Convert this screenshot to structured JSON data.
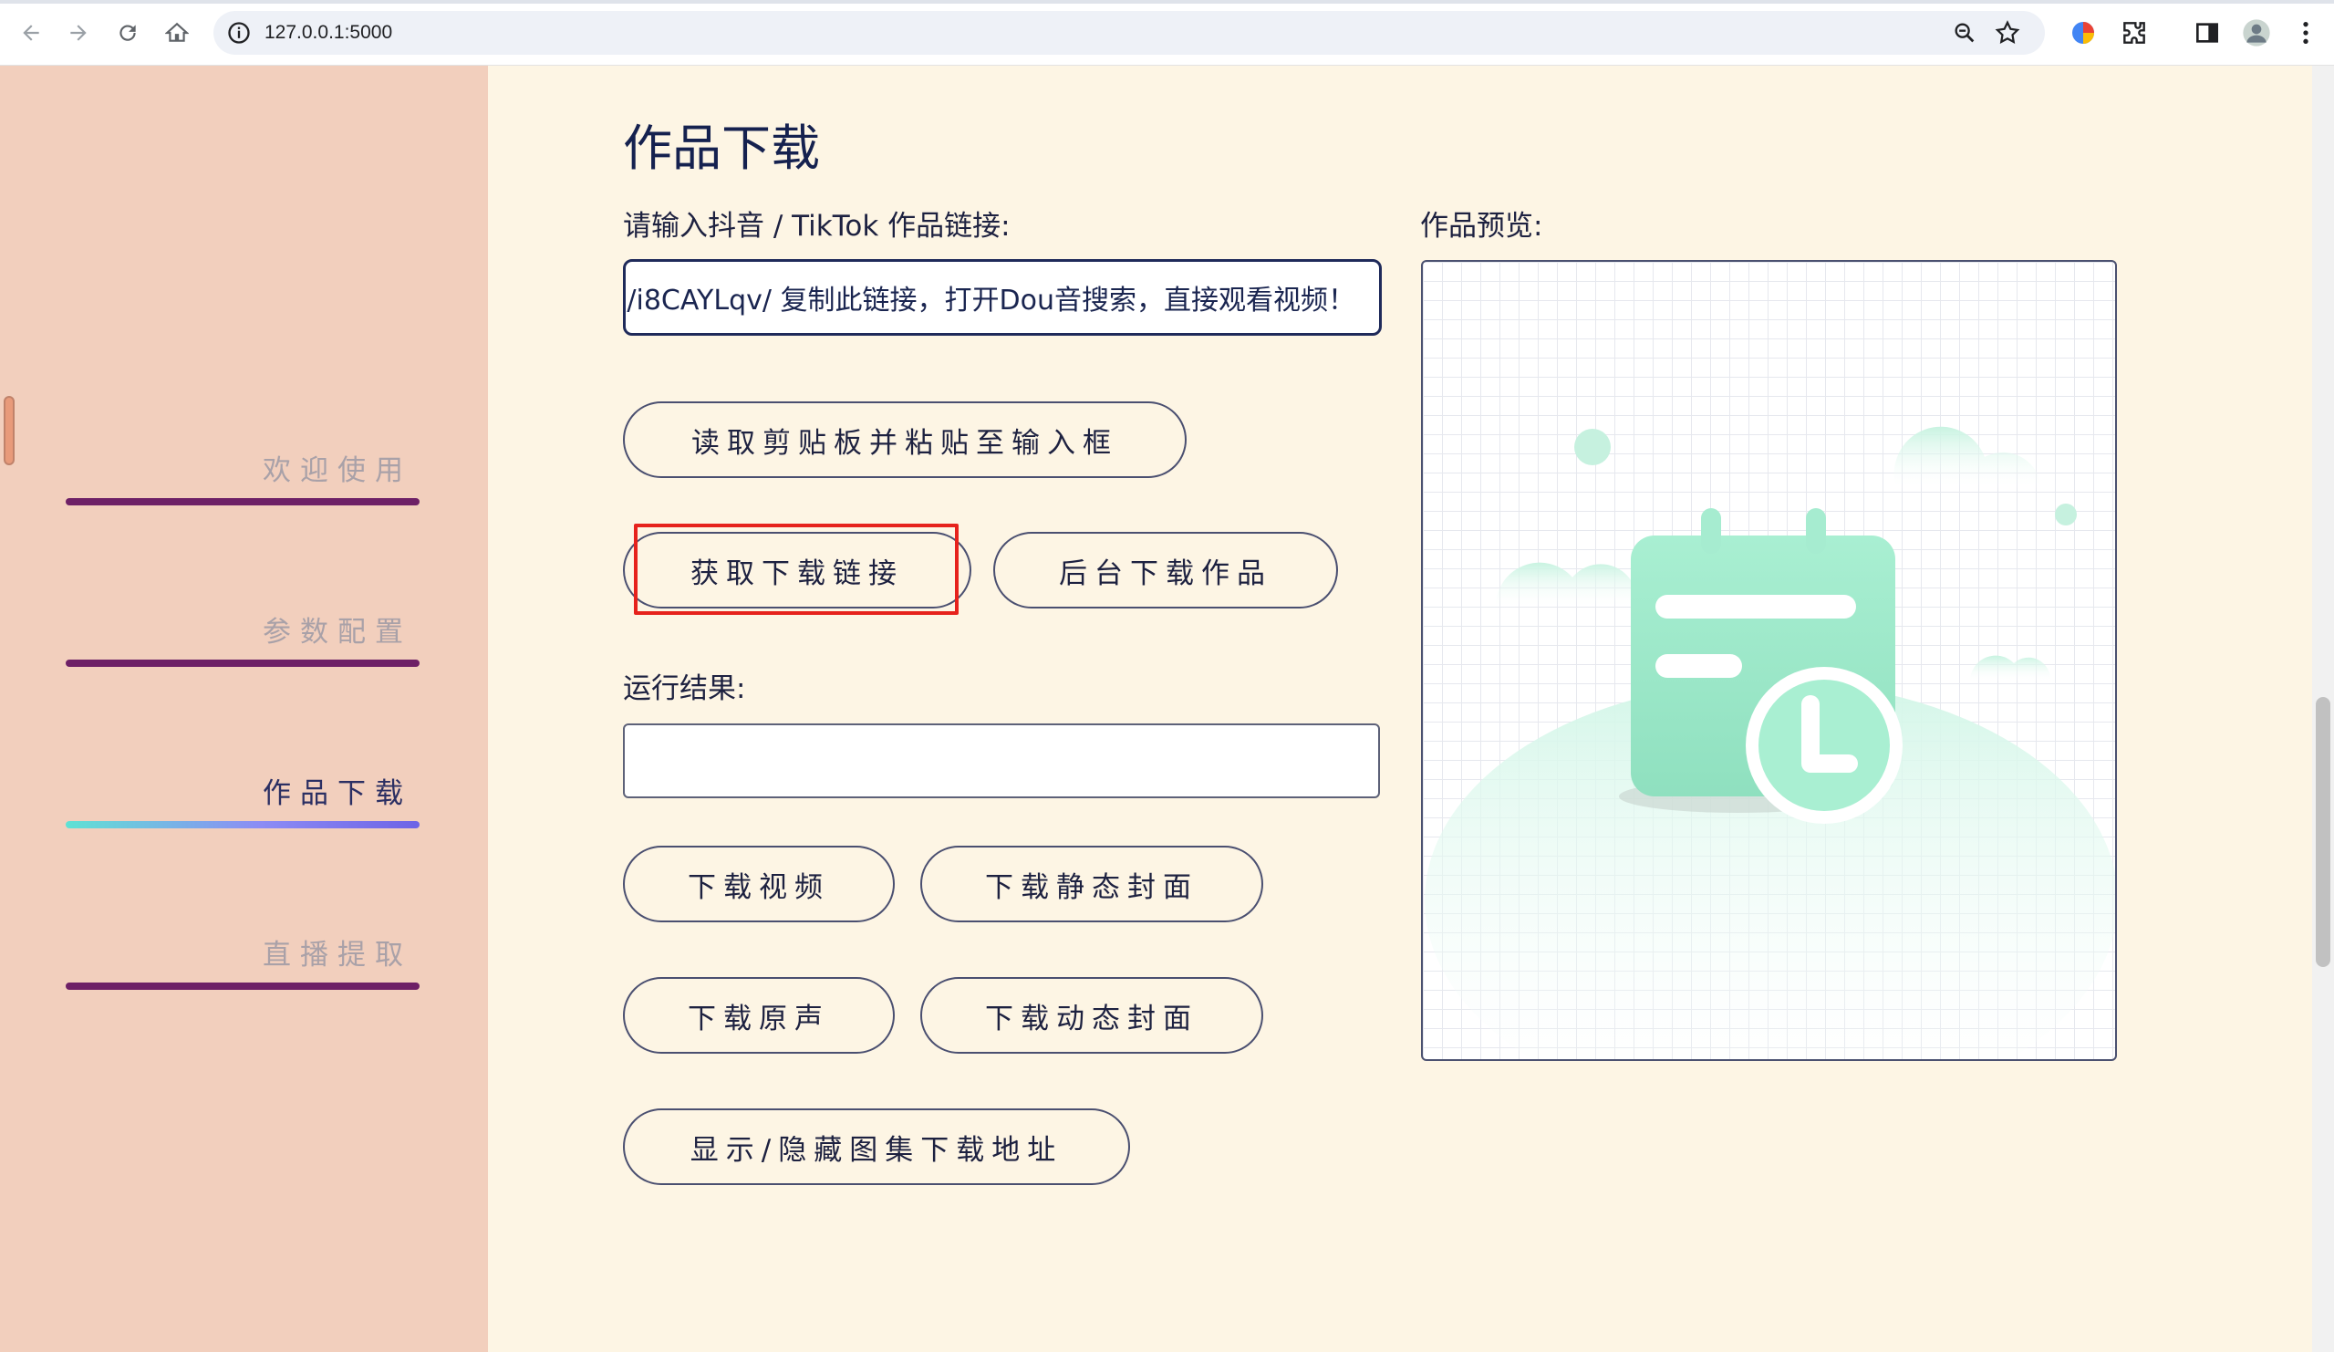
{
  "browser": {
    "url": "127.0.0.1:5000"
  },
  "sidebar": {
    "items": [
      {
        "label": "欢迎使用",
        "active": false
      },
      {
        "label": "参数配置",
        "active": false
      },
      {
        "label": "作品下载",
        "active": true
      },
      {
        "label": "直播提取",
        "active": false
      }
    ]
  },
  "main": {
    "title": "作品下载",
    "input_label": "请输入抖音 / TikTok 作品链接:",
    "input_value": "/i8CAYLqv/ 复制此链接，打开Dou音搜索，直接观看视频！",
    "buttons": {
      "paste": "读取剪贴板并粘贴至输入框",
      "get_link": "获取下载链接",
      "bg_download": "后台下载作品",
      "download_video": "下载视频",
      "download_static_cover": "下载静态封面",
      "download_audio": "下载原声",
      "download_dynamic_cover": "下载动态封面",
      "toggle_gallery": "显示/隐藏图集下载地址"
    },
    "result_label": "运行结果:",
    "result_value": "",
    "preview_label": "作品预览:"
  },
  "colors": {
    "sidebar_bg": "#f2cfbd",
    "main_bg": "#fdf5e4",
    "sidebar_bar": "#6e2066",
    "highlight": "#e6221c"
  }
}
